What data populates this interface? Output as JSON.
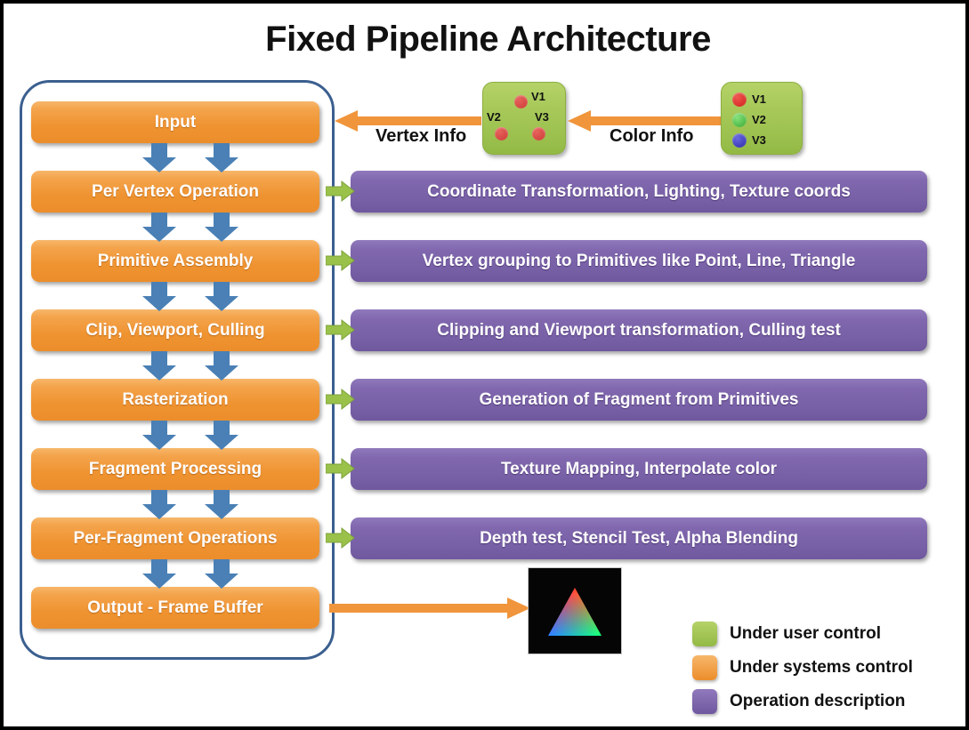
{
  "title": "Fixed Pipeline Architecture",
  "colors": {
    "orange": "#ee9a38",
    "purple": "#7e63ac",
    "green": "#a5c755",
    "blue_arrow": "#4a80b5",
    "container_border": "#3b5f8f",
    "page_border": "#000000"
  },
  "pipeline": {
    "stages": [
      {
        "label": "Input"
      },
      {
        "label": "Per Vertex Operation"
      },
      {
        "label": "Primitive Assembly"
      },
      {
        "label": "Clip, Viewport, Culling"
      },
      {
        "label": "Rasterization"
      },
      {
        "label": "Fragment Processing"
      },
      {
        "label": "Per-Fragment Operations"
      },
      {
        "label": "Output - Frame Buffer"
      }
    ]
  },
  "descriptions": [
    {
      "label": "Coordinate Transformation, Lighting, Texture coords"
    },
    {
      "label": "Vertex grouping to Primitives like Point, Line, Triangle"
    },
    {
      "label": "Clipping and Viewport transformation, Culling test"
    },
    {
      "label": "Generation of Fragment from Primitives"
    },
    {
      "label": "Texture Mapping, Interpolate color"
    },
    {
      "label": "Depth test, Stencil Test, Alpha Blending"
    }
  ],
  "flow": {
    "vertex_info_label": "Vertex Info",
    "color_info_label": "Color Info"
  },
  "vertex_box": {
    "vertices": [
      {
        "name": "V1",
        "color": "#d9453f"
      },
      {
        "name": "V2",
        "color": "#d9453f"
      },
      {
        "name": "V3",
        "color": "#d9453f"
      }
    ]
  },
  "color_box": {
    "vertices": [
      {
        "name": "V1",
        "color": "#e02b26"
      },
      {
        "name": "V2",
        "color": "#4fbf48"
      },
      {
        "name": "V3",
        "color": "#4040c8"
      }
    ]
  },
  "framebuffer": {
    "alt": "rgb-gradient-triangle",
    "apex_color": "#ff0000",
    "left_color": "#0000ff",
    "right_color": "#00ff00",
    "background": "#050505"
  },
  "legend": {
    "items": [
      {
        "label": "Under user control",
        "color": "#a5c755"
      },
      {
        "label": "Under systems control",
        "color": "#ee9a38"
      },
      {
        "label": "Operation description",
        "color": "#7e63ac"
      }
    ]
  }
}
